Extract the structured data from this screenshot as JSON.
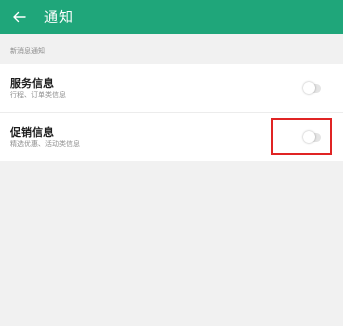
{
  "header": {
    "back_icon": "arrow-left-icon",
    "title": "通知"
  },
  "section": {
    "label": "新消息通知"
  },
  "settings": [
    {
      "title": "服务信息",
      "subtitle": "行程、订单类信息",
      "toggle_on": false
    },
    {
      "title": "促销信息",
      "subtitle": "精选优惠、活动类信息",
      "toggle_on": false
    }
  ],
  "colors": {
    "header_bg": "#1fa67a",
    "page_bg": "#f1f1f1",
    "highlight": "#e02424"
  }
}
